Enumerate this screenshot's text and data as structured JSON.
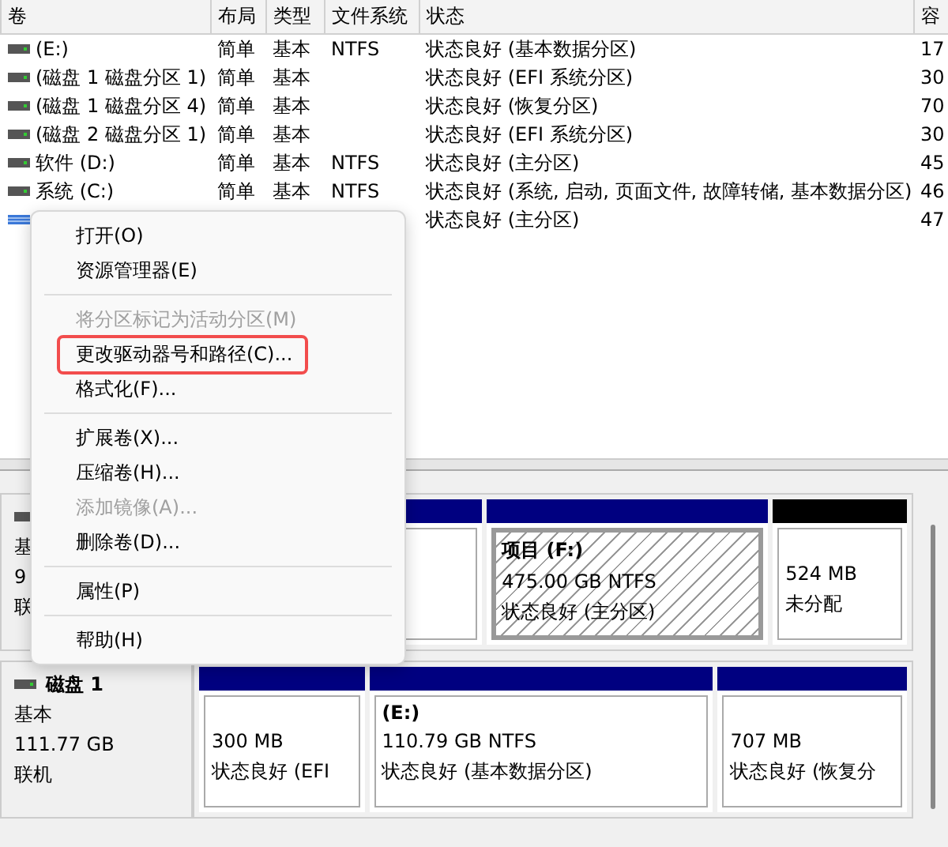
{
  "volume_table": {
    "columns": [
      "卷",
      "布局",
      "类型",
      "文件系统",
      "状态",
      "容"
    ],
    "rows": [
      {
        "volume": "(E:)",
        "layout": "简单",
        "type": "基本",
        "fs": "NTFS",
        "status": "状态良好 (基本数据分区)",
        "capacity": "17",
        "selected": false
      },
      {
        "volume": "(磁盘 1 磁盘分区 1)",
        "layout": "简单",
        "type": "基本",
        "status": "状态良好 (EFI 系统分区)",
        "capacity": "30",
        "selected": false
      },
      {
        "volume": "(磁盘 1 磁盘分区 4)",
        "layout": "简单",
        "type": "基本",
        "status": "状态良好 (恢复分区)",
        "capacity": "70",
        "selected": false
      },
      {
        "volume": "(磁盘 2 磁盘分区 1)",
        "layout": "简单",
        "type": "基本",
        "status": "状态良好 (EFI 系统分区)",
        "capacity": "30",
        "selected": false
      },
      {
        "volume": "软件 (D:)",
        "layout": "简单",
        "type": "基本",
        "fs": "NTFS",
        "status": "状态良好 (主分区)",
        "capacity": "45",
        "selected": false
      },
      {
        "volume": "系统 (C:)",
        "layout": "简单",
        "type": "基本",
        "fs": "NTFS",
        "status": "状态良好 (系统, 启动, 页面文件, 故障转储, 基本数据分区)",
        "capacity": "46",
        "selected": false
      },
      {
        "status": "状态良好 (主分区)",
        "capacity": "47",
        "selected": true
      }
    ]
  },
  "disks": [
    {
      "lines": [
        "基",
        "9",
        "联"
      ],
      "partitions": [
        {
          "kind": "primary",
          "selected": false
        },
        {
          "kind": "primary",
          "title": "项目  (F:)",
          "size": "475.00 GB NTFS",
          "status": "状态良好 (主分区)",
          "selected": true
        },
        {
          "kind": "unallocated",
          "size": "524 MB",
          "status": "未分配",
          "selected": false
        }
      ]
    },
    {
      "name": "磁盘 1",
      "lines": [
        "基本",
        "111.77 GB",
        "联机"
      ],
      "partitions": [
        {
          "kind": "primary",
          "size": "300 MB",
          "status": "状态良好 (EFI",
          "selected": false
        },
        {
          "kind": "primary",
          "title": "(E:)",
          "size": "110.79 GB NTFS",
          "status": "状态良好 (基本数据分区)",
          "selected": false
        },
        {
          "kind": "primary",
          "size": "707 MB",
          "status": "状态良好 (恢复分",
          "selected": false
        }
      ]
    }
  ],
  "context_menu": [
    {
      "kind": "item",
      "label": "打开(O)",
      "disabled": false,
      "highlighted": false
    },
    {
      "kind": "item",
      "label": "资源管理器(E)",
      "disabled": false,
      "highlighted": false
    },
    {
      "kind": "separator"
    },
    {
      "kind": "item",
      "label": "将分区标记为活动分区(M)",
      "disabled": true,
      "highlighted": false
    },
    {
      "kind": "item",
      "label": "更改驱动器号和路径(C)...",
      "disabled": false,
      "highlighted": true
    },
    {
      "kind": "item",
      "label": "格式化(F)...",
      "disabled": false,
      "highlighted": false
    },
    {
      "kind": "separator"
    },
    {
      "kind": "item",
      "label": "扩展卷(X)...",
      "disabled": false,
      "highlighted": false
    },
    {
      "kind": "item",
      "label": "压缩卷(H)...",
      "disabled": false,
      "highlighted": false
    },
    {
      "kind": "item",
      "label": "添加镜像(A)...",
      "disabled": true,
      "highlighted": false
    },
    {
      "kind": "item",
      "label": "删除卷(D)...",
      "disabled": false,
      "highlighted": false
    },
    {
      "kind": "separator"
    },
    {
      "kind": "item",
      "label": "属性(P)",
      "disabled": false,
      "highlighted": false
    },
    {
      "kind": "separator"
    },
    {
      "kind": "item",
      "label": "帮助(H)",
      "disabled": false,
      "highlighted": false
    }
  ]
}
